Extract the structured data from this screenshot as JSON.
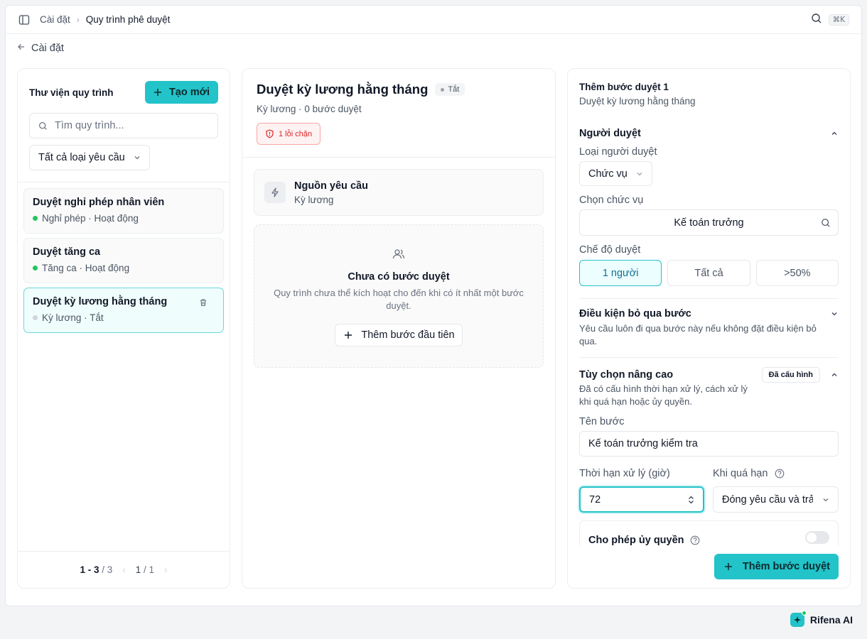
{
  "breadcrumb": {
    "parent": "Cài đặt",
    "current": "Quy trình phê duyệt"
  },
  "topbar": {
    "shortcut": "⌘K"
  },
  "back_label": "Cài đặt",
  "library": {
    "title": "Thư viện quy trình",
    "new_button": "Tạo mới",
    "search_placeholder": "Tìm quy trình...",
    "filter_value": "Tất cả loại yêu cầu",
    "items": [
      {
        "name": "Duyệt nghỉ phép nhân viên",
        "meta": "Nghỉ phép · Hoạt động",
        "status_color": "#22c55e"
      },
      {
        "name": "Duyệt tăng ca",
        "meta": "Tăng ca · Hoạt động",
        "status_color": "#22c55e"
      },
      {
        "name": "Duyệt kỳ lương hằng tháng",
        "meta": "Kỳ lương · Tắt",
        "status_color": "#d1d5db"
      }
    ],
    "pagination": {
      "range": "1 - 3",
      "total": "/ 3",
      "page": "1",
      "pages": "/ 1"
    }
  },
  "workflow": {
    "title": "Duyệt kỳ lương hằng tháng",
    "status": "Tắt",
    "subtitle": "Kỳ lương · 0 bước duyệt",
    "error_badge": "1 lỗi chặn",
    "source": {
      "title": "Nguồn yêu cầu",
      "value": "Kỳ lương"
    },
    "empty": {
      "title": "Chưa có bước duyệt",
      "desc": "Quy trình chưa thể kích hoạt cho đến khi có ít nhất một bước duyệt.",
      "button": "Thêm bước đầu tiên"
    }
  },
  "step": {
    "title": "Thêm bước duyệt 1",
    "subtitle": "Duyệt kỳ lương hằng tháng",
    "approver": {
      "section_title": "Người duyệt",
      "type_label": "Loại người duyệt",
      "type_value": "Chức vụ",
      "role_label": "Chọn chức vụ",
      "role_value": "Kế toán trưởng",
      "mode_label": "Chế độ duyệt",
      "modes": [
        "1 người",
        "Tất cả",
        ">50%"
      ]
    },
    "skip": {
      "title": "Điều kiện bỏ qua bước",
      "desc": "Yêu cầu luôn đi qua bước này nếu không đặt điều kiện bỏ qua."
    },
    "advanced": {
      "title": "Tùy chọn nâng cao",
      "tag": "Đã cấu hình",
      "desc": "Đã có cấu hình thời hạn xử lý, cách xử lý khi quá hạn hoặc ủy quyền.",
      "name_label": "Tên bước",
      "name_value": "Kế toán trưởng kiểm tra",
      "deadline_label": "Thời hạn xử lý (giờ)",
      "deadline_value": "72",
      "overdue_label": "Khi quá hạn",
      "overdue_value": "Đóng yêu cầu và trả",
      "delegate_label": "Cho phép ủy quyền"
    },
    "add_button": "Thêm bước duyệt"
  },
  "brand": "Rifena AI",
  "colors": {
    "accent": "#22c3c9",
    "danger": "#dc2626",
    "active": "#22c55e"
  }
}
